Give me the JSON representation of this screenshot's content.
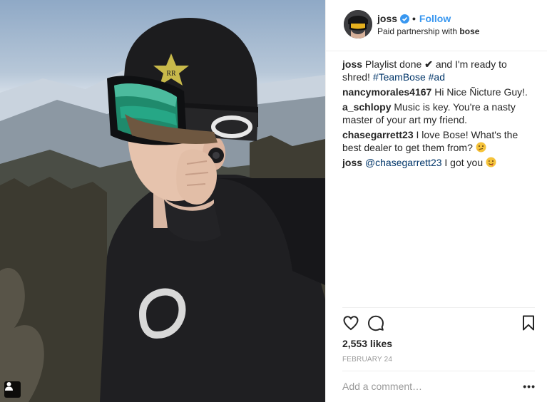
{
  "post": {
    "photo_alt": "",
    "user_tag_icon": "person-tag-icon"
  },
  "header": {
    "username": "joss",
    "verified_icon": "verified-badge-icon",
    "separator": "•",
    "follow_label": "Follow",
    "partnership_prefix": "Paid partnership with",
    "partner_name": "bose"
  },
  "comments": [
    {
      "user": "joss",
      "text_before": "Playlist done",
      "check": "✔",
      "text_after": "and I'm ready to shred!",
      "tags": [
        "#TeamBose",
        "#ad"
      ]
    },
    {
      "user": "nancymorales4167",
      "text": "Hi Nice Ñicture Guy!."
    },
    {
      "user": "a_schlopy",
      "text": "Music is key. You're a nasty master of your art my friend."
    },
    {
      "user": "chasegarrett23",
      "text": "I love Bose! What's the best dealer to get them from?",
      "emoji": "thinking-face-emoji"
    },
    {
      "user": "joss",
      "mention": "@chasegarrett23",
      "text": "I got you",
      "emoji": "winking-tongue-face-emoji"
    }
  ],
  "actions": {
    "like_icon": "heart-icon",
    "comment_icon": "comment-bubble-icon",
    "save_icon": "bookmark-icon"
  },
  "likes": "2,553 likes",
  "date": "FEBRUARY 24",
  "comment_box": {
    "placeholder": "Add a comment…",
    "more_label": "•••"
  },
  "colors": {
    "link_blue": "#3897f0",
    "hashtag": "#003569",
    "muted": "#999999",
    "text": "#262626"
  }
}
